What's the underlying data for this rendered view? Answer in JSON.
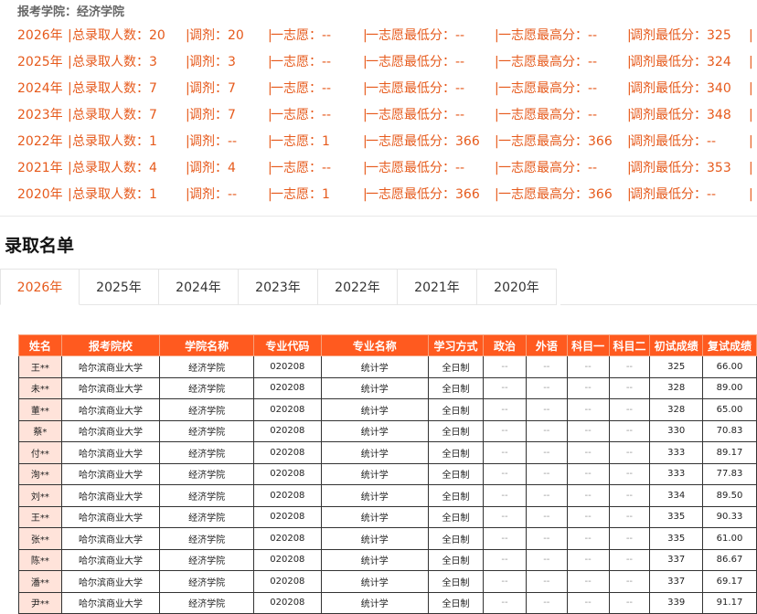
{
  "school_line": "报考学院：经济学院",
  "stats": [
    {
      "year": "2026年",
      "total": "总录取人数：20",
      "adjust": "调剂：20",
      "first": "一志愿：--",
      "first_min": "一志愿最低分：--",
      "first_max": "一志愿最高分：--",
      "adjust_min": "调剂最低分：325"
    },
    {
      "year": "2025年",
      "total": "总录取人数：3",
      "adjust": "调剂：3",
      "first": "一志愿：--",
      "first_min": "一志愿最低分：--",
      "first_max": "一志愿最高分：--",
      "adjust_min": "调剂最低分：324"
    },
    {
      "year": "2024年",
      "total": "总录取人数：7",
      "adjust": "调剂：7",
      "first": "一志愿：--",
      "first_min": "一志愿最低分：--",
      "first_max": "一志愿最高分：--",
      "adjust_min": "调剂最低分：340"
    },
    {
      "year": "2023年",
      "total": "总录取人数：7",
      "adjust": "调剂：7",
      "first": "一志愿：--",
      "first_min": "一志愿最低分：--",
      "first_max": "一志愿最高分：--",
      "adjust_min": "调剂最低分：348"
    },
    {
      "year": "2022年",
      "total": "总录取人数：1",
      "adjust": "调剂：--",
      "first": "一志愿：1",
      "first_min": "一志愿最低分：366",
      "first_max": "一志愿最高分：366",
      "adjust_min": "调剂最低分：--"
    },
    {
      "year": "2021年",
      "total": "总录取人数：4",
      "adjust": "调剂：4",
      "first": "一志愿：--",
      "first_min": "一志愿最低分：--",
      "first_max": "一志愿最高分：--",
      "adjust_min": "调剂最低分：353"
    },
    {
      "year": "2020年",
      "total": "总录取人数：1",
      "adjust": "调剂：--",
      "first": "一志愿：1",
      "first_min": "一志愿最低分：366",
      "first_max": "一志愿最高分：366",
      "adjust_min": "调剂最低分：--"
    }
  ],
  "separator": "|",
  "list_title": "录取名单",
  "tabs": [
    "2026年",
    "2025年",
    "2024年",
    "2023年",
    "2022年",
    "2021年",
    "2020年"
  ],
  "active_tab": "2026年",
  "table": {
    "headers": [
      "姓名",
      "报考院校",
      "学院名称",
      "专业代码",
      "专业名称",
      "学习方式",
      "政治",
      "外语",
      "科目一",
      "科目二",
      "初试成绩",
      "复试成绩"
    ],
    "rows": [
      [
        "王**",
        "哈尔滨商业大学",
        "经济学院",
        "020208",
        "统计学",
        "全日制",
        "--",
        "--",
        "--",
        "--",
        "325",
        "66.00"
      ],
      [
        "未**",
        "哈尔滨商业大学",
        "经济学院",
        "020208",
        "统计学",
        "全日制",
        "--",
        "--",
        "--",
        "--",
        "328",
        "89.00"
      ],
      [
        "董**",
        "哈尔滨商业大学",
        "经济学院",
        "020208",
        "统计学",
        "全日制",
        "--",
        "--",
        "--",
        "--",
        "328",
        "65.00"
      ],
      [
        "蔡*",
        "哈尔滨商业大学",
        "经济学院",
        "020208",
        "统计学",
        "全日制",
        "--",
        "--",
        "--",
        "--",
        "330",
        "70.83"
      ],
      [
        "付**",
        "哈尔滨商业大学",
        "经济学院",
        "020208",
        "统计学",
        "全日制",
        "--",
        "--",
        "--",
        "--",
        "333",
        "89.17"
      ],
      [
        "洵**",
        "哈尔滨商业大学",
        "经济学院",
        "020208",
        "统计学",
        "全日制",
        "--",
        "--",
        "--",
        "--",
        "333",
        "77.83"
      ],
      [
        "刘**",
        "哈尔滨商业大学",
        "经济学院",
        "020208",
        "统计学",
        "全日制",
        "--",
        "--",
        "--",
        "--",
        "334",
        "89.50"
      ],
      [
        "王**",
        "哈尔滨商业大学",
        "经济学院",
        "020208",
        "统计学",
        "全日制",
        "--",
        "--",
        "--",
        "--",
        "335",
        "90.33"
      ],
      [
        "张**",
        "哈尔滨商业大学",
        "经济学院",
        "020208",
        "统计学",
        "全日制",
        "--",
        "--",
        "--",
        "--",
        "335",
        "61.00"
      ],
      [
        "陈**",
        "哈尔滨商业大学",
        "经济学院",
        "020208",
        "统计学",
        "全日制",
        "--",
        "--",
        "--",
        "--",
        "337",
        "86.67"
      ],
      [
        "潘**",
        "哈尔滨商业大学",
        "经济学院",
        "020208",
        "统计学",
        "全日制",
        "--",
        "--",
        "--",
        "--",
        "337",
        "69.17"
      ],
      [
        "尹**",
        "哈尔滨商业大学",
        "经济学院",
        "020208",
        "统计学",
        "全日制",
        "--",
        "--",
        "--",
        "--",
        "339",
        "91.17"
      ]
    ]
  },
  "colors": {
    "accent": "#e65a1c",
    "header_bg": "#ff5a1f",
    "name_cell_bg": "#ffe3da"
  }
}
